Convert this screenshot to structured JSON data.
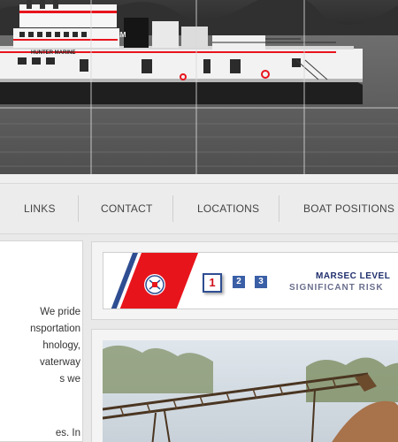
{
  "hero": {
    "boat_name": "HUNTER MARINE",
    "bow_letters": "HM"
  },
  "nav": {
    "items": [
      {
        "label": "LINKS",
        "name": "nav-links"
      },
      {
        "label": "CONTACT",
        "name": "nav-contact"
      },
      {
        "label": "LOCATIONS",
        "name": "nav-locations"
      },
      {
        "label": "BOAT POSITIONS",
        "name": "nav-boat-positions"
      }
    ]
  },
  "intro": {
    "lines": [
      "We pride",
      "nsportation",
      "hnology,",
      "vaterway",
      "s we",
      "",
      "es. In"
    ]
  },
  "marsec": {
    "levels": [
      "1",
      "2",
      "3"
    ],
    "active_level": "1",
    "title": "MARSEC LEVEL",
    "status": "SIGNIFICANT RISK"
  },
  "colors": {
    "accent_red": "#e8141c",
    "accent_blue": "#2f4e92",
    "nav_text": "#444444"
  }
}
